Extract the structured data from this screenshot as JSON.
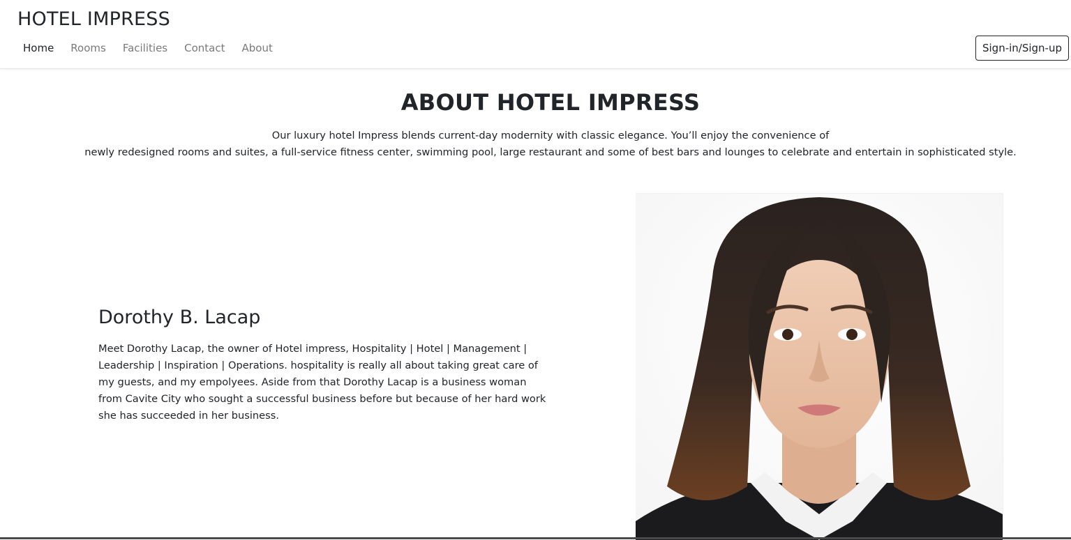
{
  "brand": "HOTEL IMPRESS",
  "nav": {
    "items": [
      {
        "label": "Home",
        "active": true
      },
      {
        "label": "Rooms",
        "active": false
      },
      {
        "label": "Facilities",
        "active": false
      },
      {
        "label": "Contact",
        "active": false
      },
      {
        "label": "About",
        "active": false
      }
    ],
    "signin_label": "Sign-in/Sign-up"
  },
  "about": {
    "title": "ABOUT HOTEL IMPRESS",
    "intro_line1": "Our luxury hotel Impress blends current-day modernity with classic elegance. You’ll enjoy the convenience of",
    "intro_line2": "newly redesigned rooms and suites, a full-service fitness center, swimming pool, large restaurant and some of best bars and lounges to celebrate and entertain in sophisticated style."
  },
  "owner": {
    "name": "Dorothy B. Lacap",
    "bio": "Meet Dorothy Lacap, the owner of Hotel impress, Hospitality | Hotel | Management | Leadership | Inspiration | Operations. hospitality is really all about taking great care of my guests, and my empolyees. Aside from that Dorothy Lacap is a business woman from Cavite City who sought a successful business before but because of her hard work she has succeeded in her business."
  },
  "colors": {
    "text": "#212529",
    "muted_nav": "#7a7a7a",
    "background": "#ffffff"
  }
}
